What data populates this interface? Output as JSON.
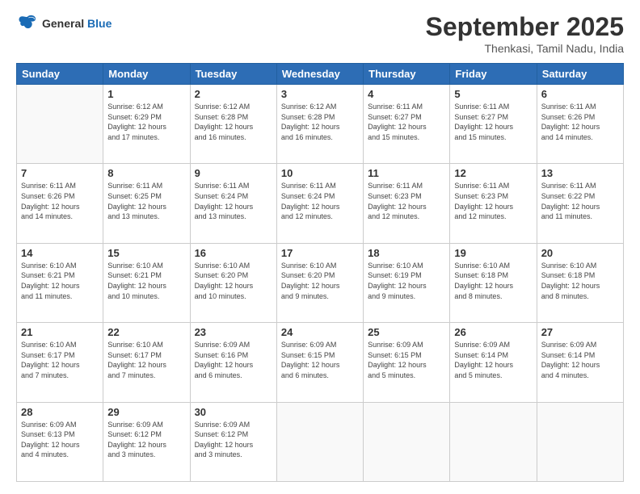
{
  "header": {
    "logo_line1": "General",
    "logo_line2": "Blue",
    "month": "September 2025",
    "location": "Thenkasi, Tamil Nadu, India"
  },
  "days_of_week": [
    "Sunday",
    "Monday",
    "Tuesday",
    "Wednesday",
    "Thursday",
    "Friday",
    "Saturday"
  ],
  "weeks": [
    [
      {
        "day": "",
        "info": ""
      },
      {
        "day": "1",
        "info": "Sunrise: 6:12 AM\nSunset: 6:29 PM\nDaylight: 12 hours\nand 17 minutes."
      },
      {
        "day": "2",
        "info": "Sunrise: 6:12 AM\nSunset: 6:28 PM\nDaylight: 12 hours\nand 16 minutes."
      },
      {
        "day": "3",
        "info": "Sunrise: 6:12 AM\nSunset: 6:28 PM\nDaylight: 12 hours\nand 16 minutes."
      },
      {
        "day": "4",
        "info": "Sunrise: 6:11 AM\nSunset: 6:27 PM\nDaylight: 12 hours\nand 15 minutes."
      },
      {
        "day": "5",
        "info": "Sunrise: 6:11 AM\nSunset: 6:27 PM\nDaylight: 12 hours\nand 15 minutes."
      },
      {
        "day": "6",
        "info": "Sunrise: 6:11 AM\nSunset: 6:26 PM\nDaylight: 12 hours\nand 14 minutes."
      }
    ],
    [
      {
        "day": "7",
        "info": "Sunrise: 6:11 AM\nSunset: 6:26 PM\nDaylight: 12 hours\nand 14 minutes."
      },
      {
        "day": "8",
        "info": "Sunrise: 6:11 AM\nSunset: 6:25 PM\nDaylight: 12 hours\nand 13 minutes."
      },
      {
        "day": "9",
        "info": "Sunrise: 6:11 AM\nSunset: 6:24 PM\nDaylight: 12 hours\nand 13 minutes."
      },
      {
        "day": "10",
        "info": "Sunrise: 6:11 AM\nSunset: 6:24 PM\nDaylight: 12 hours\nand 12 minutes."
      },
      {
        "day": "11",
        "info": "Sunrise: 6:11 AM\nSunset: 6:23 PM\nDaylight: 12 hours\nand 12 minutes."
      },
      {
        "day": "12",
        "info": "Sunrise: 6:11 AM\nSunset: 6:23 PM\nDaylight: 12 hours\nand 12 minutes."
      },
      {
        "day": "13",
        "info": "Sunrise: 6:11 AM\nSunset: 6:22 PM\nDaylight: 12 hours\nand 11 minutes."
      }
    ],
    [
      {
        "day": "14",
        "info": "Sunrise: 6:10 AM\nSunset: 6:21 PM\nDaylight: 12 hours\nand 11 minutes."
      },
      {
        "day": "15",
        "info": "Sunrise: 6:10 AM\nSunset: 6:21 PM\nDaylight: 12 hours\nand 10 minutes."
      },
      {
        "day": "16",
        "info": "Sunrise: 6:10 AM\nSunset: 6:20 PM\nDaylight: 12 hours\nand 10 minutes."
      },
      {
        "day": "17",
        "info": "Sunrise: 6:10 AM\nSunset: 6:20 PM\nDaylight: 12 hours\nand 9 minutes."
      },
      {
        "day": "18",
        "info": "Sunrise: 6:10 AM\nSunset: 6:19 PM\nDaylight: 12 hours\nand 9 minutes."
      },
      {
        "day": "19",
        "info": "Sunrise: 6:10 AM\nSunset: 6:18 PM\nDaylight: 12 hours\nand 8 minutes."
      },
      {
        "day": "20",
        "info": "Sunrise: 6:10 AM\nSunset: 6:18 PM\nDaylight: 12 hours\nand 8 minutes."
      }
    ],
    [
      {
        "day": "21",
        "info": "Sunrise: 6:10 AM\nSunset: 6:17 PM\nDaylight: 12 hours\nand 7 minutes."
      },
      {
        "day": "22",
        "info": "Sunrise: 6:10 AM\nSunset: 6:17 PM\nDaylight: 12 hours\nand 7 minutes."
      },
      {
        "day": "23",
        "info": "Sunrise: 6:09 AM\nSunset: 6:16 PM\nDaylight: 12 hours\nand 6 minutes."
      },
      {
        "day": "24",
        "info": "Sunrise: 6:09 AM\nSunset: 6:15 PM\nDaylight: 12 hours\nand 6 minutes."
      },
      {
        "day": "25",
        "info": "Sunrise: 6:09 AM\nSunset: 6:15 PM\nDaylight: 12 hours\nand 5 minutes."
      },
      {
        "day": "26",
        "info": "Sunrise: 6:09 AM\nSunset: 6:14 PM\nDaylight: 12 hours\nand 5 minutes."
      },
      {
        "day": "27",
        "info": "Sunrise: 6:09 AM\nSunset: 6:14 PM\nDaylight: 12 hours\nand 4 minutes."
      }
    ],
    [
      {
        "day": "28",
        "info": "Sunrise: 6:09 AM\nSunset: 6:13 PM\nDaylight: 12 hours\nand 4 minutes."
      },
      {
        "day": "29",
        "info": "Sunrise: 6:09 AM\nSunset: 6:12 PM\nDaylight: 12 hours\nand 3 minutes."
      },
      {
        "day": "30",
        "info": "Sunrise: 6:09 AM\nSunset: 6:12 PM\nDaylight: 12 hours\nand 3 minutes."
      },
      {
        "day": "",
        "info": ""
      },
      {
        "day": "",
        "info": ""
      },
      {
        "day": "",
        "info": ""
      },
      {
        "day": "",
        "info": ""
      }
    ]
  ]
}
